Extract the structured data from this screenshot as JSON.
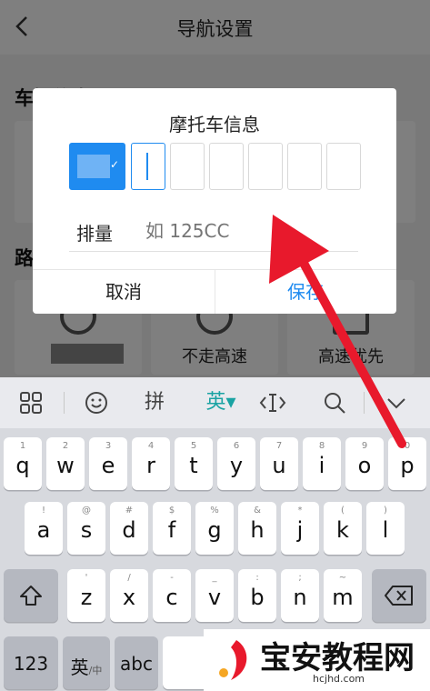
{
  "app": {
    "title": "导航设置",
    "back_icon": "chevron-left-icon",
    "section1_title": "车辆信息",
    "section2_title": "路线偏好",
    "options": [
      {
        "label": "",
        "icon": "no-fee-icon"
      },
      {
        "label": "不走高速",
        "icon": "no-highway-icon"
      },
      {
        "label": "高速优先",
        "icon": "highway-icon"
      }
    ]
  },
  "dialog": {
    "title": "摩托车信息",
    "province_value": "",
    "plate_slots": 6,
    "displacement_label": "排量",
    "displacement_placeholder": "如 125CC",
    "displacement_value": "",
    "cancel_label": "取消",
    "save_label": "保存",
    "accent_color": "#1f8bf0"
  },
  "keyboard": {
    "toolbar": {
      "grid_icon": "grid-icon",
      "emoji_icon": "emoji-icon",
      "pinyin_label": "拼",
      "english_label": "英▾",
      "cursor_icon": "cursor-move-icon",
      "search_icon": "search-icon",
      "collapse_icon": "chevron-down-icon"
    },
    "row1": [
      {
        "main": "q",
        "hint": "1"
      },
      {
        "main": "w",
        "hint": "2"
      },
      {
        "main": "e",
        "hint": "3"
      },
      {
        "main": "r",
        "hint": "4"
      },
      {
        "main": "t",
        "hint": "5"
      },
      {
        "main": "y",
        "hint": "6"
      },
      {
        "main": "u",
        "hint": "7"
      },
      {
        "main": "i",
        "hint": "8"
      },
      {
        "main": "o",
        "hint": "9"
      },
      {
        "main": "p",
        "hint": "0"
      }
    ],
    "row2": [
      {
        "main": "a",
        "hint": "!"
      },
      {
        "main": "s",
        "hint": "@"
      },
      {
        "main": "d",
        "hint": "#"
      },
      {
        "main": "f",
        "hint": "$"
      },
      {
        "main": "g",
        "hint": "%"
      },
      {
        "main": "h",
        "hint": "&"
      },
      {
        "main": "j",
        "hint": "*"
      },
      {
        "main": "k",
        "hint": "("
      },
      {
        "main": "l",
        "hint": ")"
      }
    ],
    "row3": [
      {
        "main": "z",
        "hint": "'"
      },
      {
        "main": "x",
        "hint": "/"
      },
      {
        "main": "c",
        "hint": "-"
      },
      {
        "main": "v",
        "hint": "_"
      },
      {
        "main": "b",
        "hint": ":"
      },
      {
        "main": "n",
        "hint": ";"
      },
      {
        "main": "m",
        "hint": "~"
      }
    ],
    "shift_icon": "shift-icon",
    "backspace_icon": "backspace-icon",
    "num_label": "123",
    "lang_label": "英",
    "lang_sub": "/中",
    "abc_label": "abc"
  },
  "watermark": {
    "text": "宝安教程网",
    "sub": "hcjhd.com"
  },
  "colors": {
    "accent": "#1f8bf0",
    "keyboard_active": "#1aa3a3",
    "annotation_arrow": "#e8192c"
  }
}
